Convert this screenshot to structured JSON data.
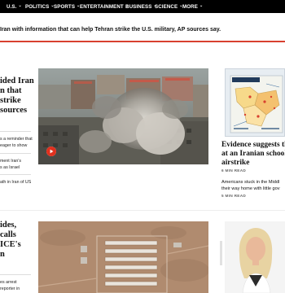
{
  "nav": {
    "items": [
      {
        "label": "U.S.",
        "name": "nav-us"
      },
      {
        "label": "POLITICS",
        "name": "nav-politics"
      },
      {
        "label": "SPORTS",
        "name": "nav-sports"
      },
      {
        "label": "ENTERTAINMENT",
        "name": "nav-entertainment"
      },
      {
        "label": "BUSINESS",
        "name": "nav-business"
      },
      {
        "label": "SCIENCE",
        "name": "nav-science"
      },
      {
        "label": "MORE",
        "name": "nav-more"
      }
    ]
  },
  "ticker": {
    "text": "Iran with information that can help Tehran strike the U.S. military, AP sources say."
  },
  "lead_story": {
    "headline_lines": [
      "ided Iran",
      "n that",
      "strike",
      "sources"
    ],
    "blurbs": [
      [
        "s a reminder that",
        "eager to show"
      ],
      [
        "ment Iran's",
        "s as Israel"
      ],
      [
        "ath in Iran of US"
      ]
    ],
    "video_label": "Video"
  },
  "right_story": {
    "headline_lines": [
      "Evidence suggests th",
      "at an Iranian school w",
      "airstrike"
    ],
    "read_time": "6 MIN READ",
    "sub_headline_lines": [
      "Americans stuck in the Middl",
      "their way home with little gov"
    ],
    "sub_read_time": "5 MIN READ"
  },
  "second_story": {
    "headline_lines": [
      "ides,",
      "calls",
      "ICE's",
      "n"
    ],
    "blurbs": [
      [
        "es arrest",
        "reporter in"
      ]
    ]
  }
}
